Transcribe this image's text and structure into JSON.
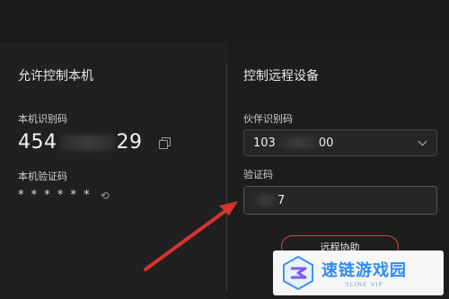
{
  "left_section": {
    "title": "允许控制本机",
    "device_code_label": "本机识别码",
    "device_code_prefix": "454",
    "device_code_suffix": "29",
    "verification_label": "本机验证码",
    "verification_value": "* * * * * *"
  },
  "right_section": {
    "title": "控制远程设备",
    "partner_code_label": "伙伴识别码",
    "partner_code_prefix": "103",
    "partner_code_suffix": "00",
    "code_label": "验证码",
    "code_suffix": "7",
    "remote_button_label": "远程协助"
  },
  "watermark": {
    "title": "速链游戏园",
    "subtitle": "SLINK VIP"
  },
  "colors": {
    "arrow": "#d8332f",
    "button_border": "#c3504a",
    "watermark_blue": "#2f8cf5"
  },
  "icons": {
    "copy": "copy-icon",
    "refresh": "refresh-icon",
    "chevron": "chevron-down-icon"
  }
}
